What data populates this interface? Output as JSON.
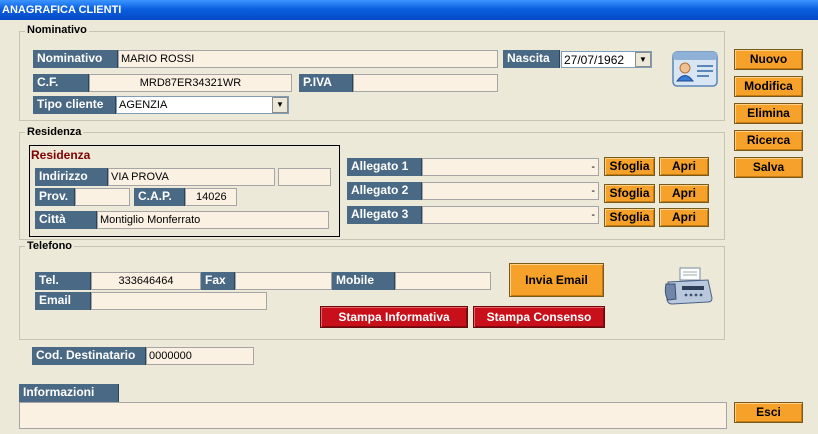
{
  "window": {
    "title": "ANAGRAFICA CLIENTI"
  },
  "nominativo": {
    "legend": "Nominativo",
    "nominativo_label": "Nominativo",
    "nominativo_value": "MARIO ROSSI",
    "nascita_label": "Nascita",
    "nascita_value": "27/07/1962",
    "cf_label": "C.F.",
    "cf_value": "MRD87ER34321WR",
    "piva_label": "P.IVA",
    "piva_value": "",
    "tipo_label": "Tipo cliente",
    "tipo_value": "AGENZIA"
  },
  "actions": {
    "nuovo": "Nuovo",
    "modifica": "Modifica",
    "elimina": "Elimina",
    "ricerca": "Ricerca",
    "salva": "Salva",
    "esci": "Esci"
  },
  "residenza": {
    "legend": "Residenza",
    "subtitle": "Residenza",
    "indirizzo_label": "Indirizzo",
    "indirizzo_value": "VIA PROVA",
    "civico_value": "",
    "prov_label": "Prov.",
    "prov_value": "",
    "cap_label": "C.A.P.",
    "cap_value": "14026",
    "citta_label": "Città",
    "citta_value": "Montiglio Monferrato"
  },
  "allegati": [
    {
      "label": "Allegato 1",
      "value": "",
      "dash": "-",
      "sfoglia": "Sfoglia",
      "apri": "Apri"
    },
    {
      "label": "Allegato 2",
      "value": "",
      "dash": "-",
      "sfoglia": "Sfoglia",
      "apri": "Apri"
    },
    {
      "label": "Allegato 3",
      "value": "",
      "dash": "-",
      "sfoglia": "Sfoglia",
      "apri": "Apri"
    }
  ],
  "telefono": {
    "legend": "Telefono",
    "tel_label": "Tel.",
    "tel_value": "333646464",
    "fax_label": "Fax",
    "fax_value": "",
    "mobile_label": "Mobile",
    "mobile_value": "",
    "email_label": "Email",
    "email_value": "",
    "invia_email": "Invia Email",
    "stampa_informativa": "Stampa Informativa",
    "stampa_consenso": "Stampa Consenso"
  },
  "destinatario": {
    "label": "Cod. Destinatario",
    "value": "0000000"
  },
  "informazioni": {
    "label": "Informazioni",
    "value": ""
  },
  "icons": {
    "contact_card": "contact-card-icon",
    "fax_machine": "fax-icon"
  }
}
